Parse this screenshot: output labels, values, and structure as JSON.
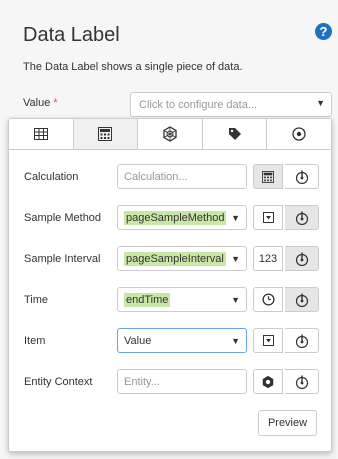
{
  "header": {
    "title": "Data Label",
    "description": "The Data Label shows a single piece of data."
  },
  "value_field": {
    "label": "Value",
    "required_mark": "*",
    "placeholder": "Click to configure data..."
  },
  "tabs": [
    {
      "icon": "table-icon",
      "active": false
    },
    {
      "icon": "calculator-icon",
      "active": true
    },
    {
      "icon": "asset-icon",
      "active": false
    },
    {
      "icon": "tag-icon",
      "active": false
    },
    {
      "icon": "target-icon",
      "active": false
    }
  ],
  "form": {
    "calculation": {
      "label": "Calculation",
      "placeholder": "Calculation..."
    },
    "sample_method": {
      "label": "Sample Method",
      "value": "pageSampleMethod"
    },
    "sample_interval": {
      "label": "Sample Interval",
      "value": "pageSampleInterval",
      "button": "123"
    },
    "time": {
      "label": "Time",
      "value": "endTime"
    },
    "item": {
      "label": "Item",
      "value": "Value"
    },
    "entity_context": {
      "label": "Entity Context",
      "placeholder": "Entity..."
    }
  },
  "preview_label": "Preview",
  "colors": {
    "highlight": "#c8e6a5",
    "help": "#1e73be",
    "required": "#d9534f"
  }
}
